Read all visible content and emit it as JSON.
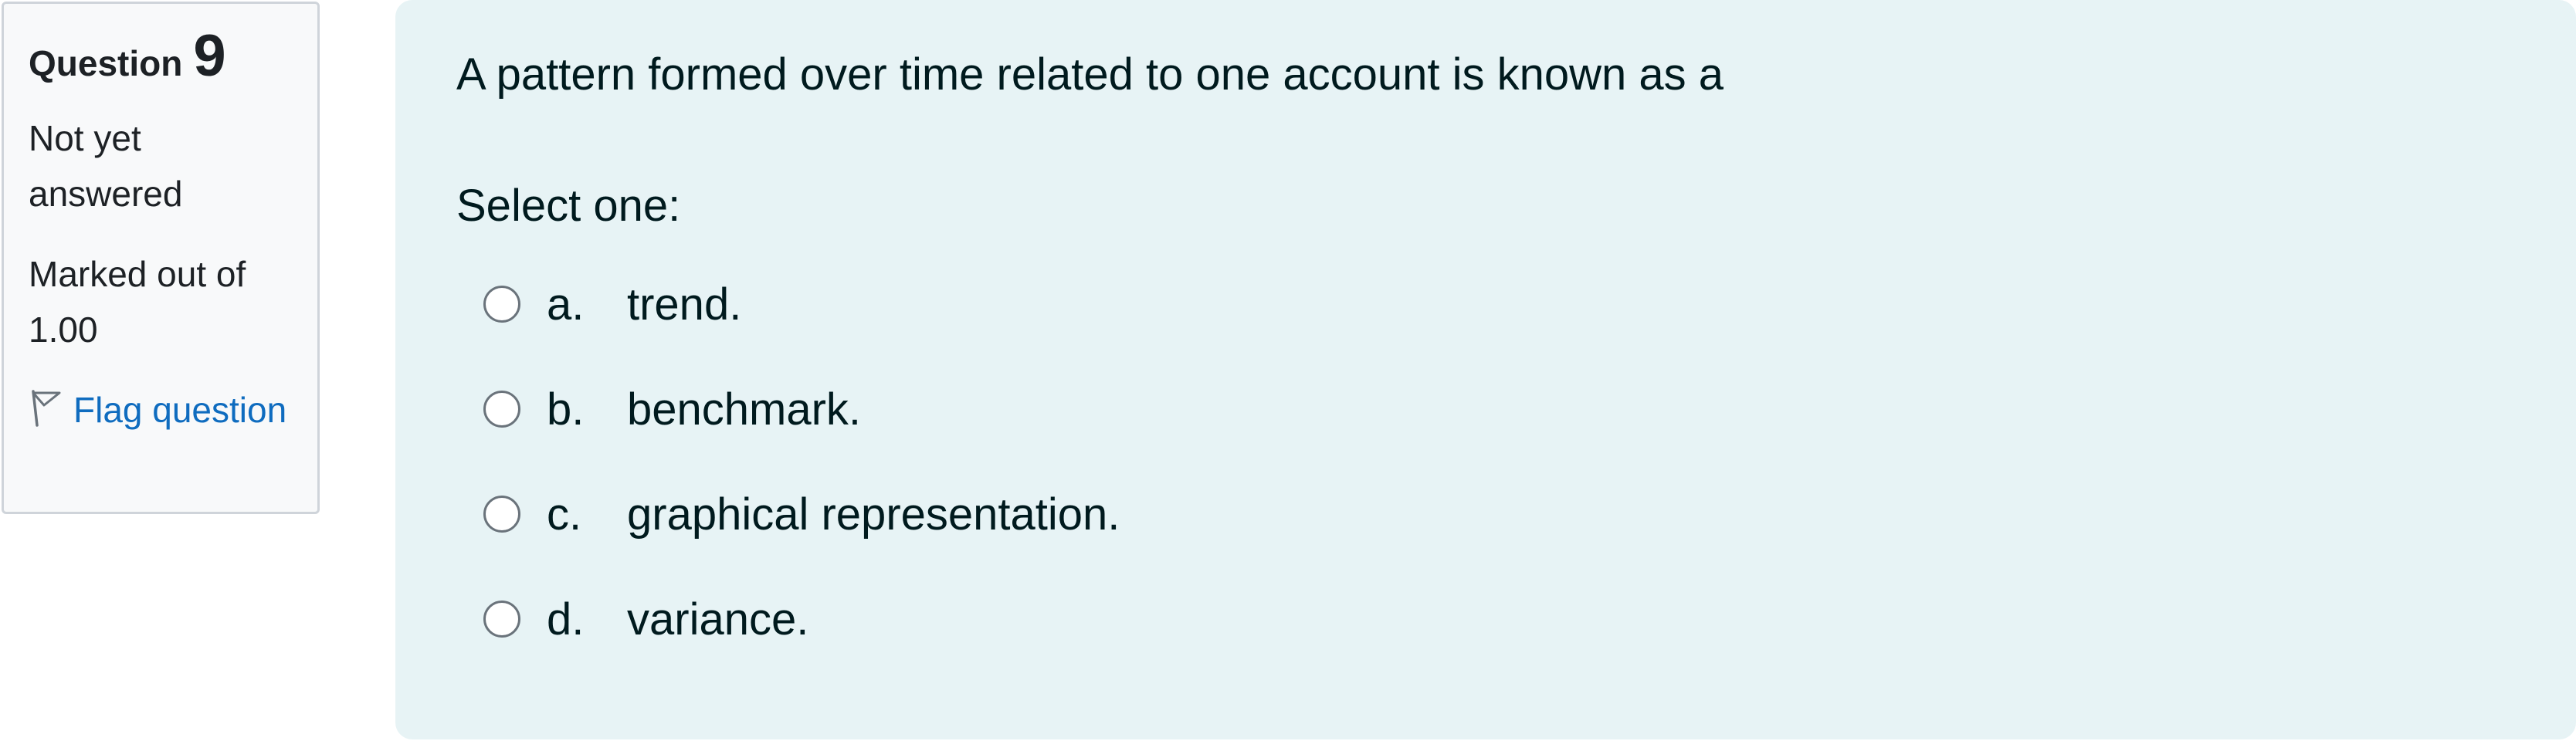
{
  "info": {
    "question_label": "Question",
    "question_number": "9",
    "state": "Not yet answered",
    "grade": "Marked out of 1.00",
    "flag_label": "Flag question",
    "flag_icon": "flag-outline-icon"
  },
  "question": {
    "text": "A pattern formed over time related to one account is known as a",
    "prompt": "Select one:",
    "options": [
      {
        "letter": "a.",
        "text": "trend.",
        "selected": false
      },
      {
        "letter": "b.",
        "text": "benchmark.",
        "selected": false
      },
      {
        "letter": "c.",
        "text": "graphical representation.",
        "selected": false
      },
      {
        "letter": "d.",
        "text": "variance.",
        "selected": false
      }
    ]
  },
  "colors": {
    "info_background": "#f8f9fa",
    "info_border": "#cfd4da",
    "content_background": "#e7f3f5",
    "link": "#0f6cbf",
    "text": "#001a1e",
    "radio_border": "#6a737b"
  }
}
